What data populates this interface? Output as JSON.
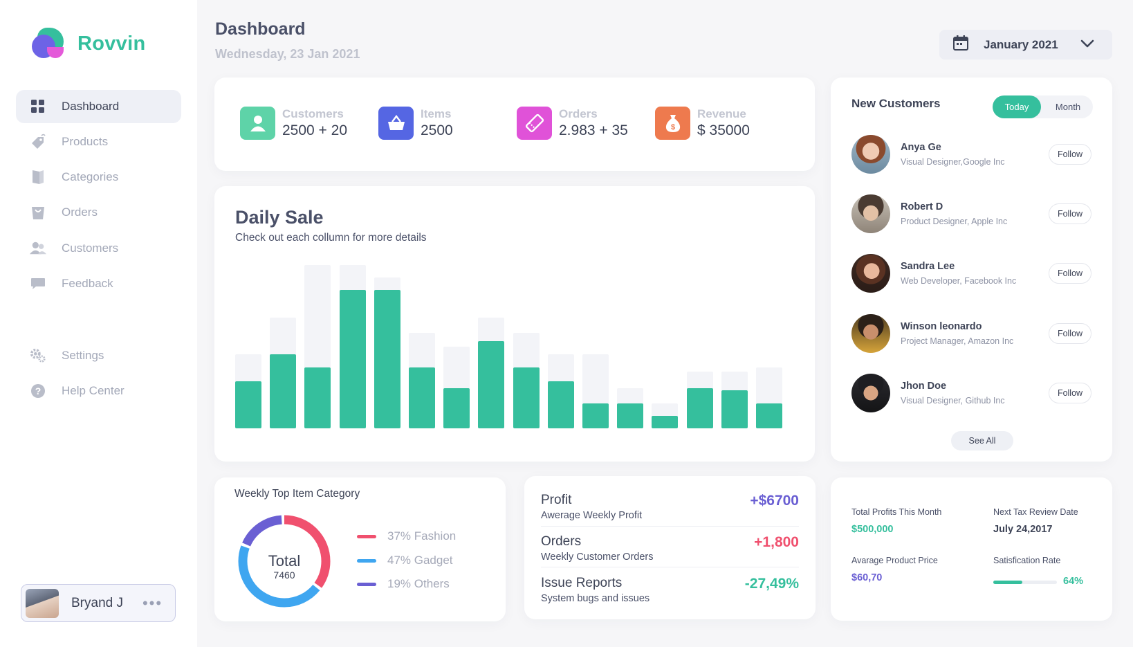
{
  "brand": {
    "name": "Rovvin",
    "color": "#35bf9d"
  },
  "sidebar": {
    "items": [
      {
        "label": "Dashboard",
        "icon": "grid-icon",
        "active": true
      },
      {
        "label": "Products",
        "icon": "tag-icon"
      },
      {
        "label": "Categories",
        "icon": "book-icon"
      },
      {
        "label": "Orders",
        "icon": "bag-icon"
      },
      {
        "label": "Customers",
        "icon": "users-icon"
      },
      {
        "label": "Feedback",
        "icon": "chat-icon"
      },
      {
        "label": "Settings",
        "icon": "gear-icon"
      },
      {
        "label": "Help Center",
        "icon": "help-icon"
      }
    ],
    "user": {
      "name": "Bryand J",
      "more": "•••"
    }
  },
  "header": {
    "title": "Dashboard",
    "date": "Wednesday, 23 Jan 2021",
    "date_picker": "January 2021"
  },
  "stats": [
    {
      "label": "Customers",
      "value": "2500 + 20",
      "color": "#5ed3a8",
      "icon": "user-icon"
    },
    {
      "label": "Items",
      "value": "2500",
      "color": "#5566e3",
      "icon": "basket-icon"
    },
    {
      "label": "Orders",
      "value": "2.983 + 35",
      "color": "#e052d8",
      "icon": "ticket-icon"
    },
    {
      "label": "Revenue",
      "value": "$ 35000",
      "color": "#ee7a4e",
      "icon": "money-bag-icon"
    }
  ],
  "daily_sale": {
    "title": "Daily Sale",
    "subtitle": "Check out each collumn for more details"
  },
  "chart_data": {
    "type": "bar",
    "title": "Daily Sale",
    "series": [
      {
        "values": [
          68,
          107,
          88,
          200,
          200,
          88,
          58,
          126,
          88,
          68,
          36,
          36,
          18,
          58,
          55,
          36
        ]
      },
      {
        "values": [
          107,
          160,
          236,
          236,
          218,
          138,
          118,
          160,
          138,
          107,
          107,
          58,
          36,
          82,
          82,
          88
        ]
      }
    ],
    "ylim": [
      0,
      240
    ],
    "grid": false,
    "colors": {
      "value": "#35bf9d",
      "background": "#f3f4f8"
    }
  },
  "new_customers": {
    "title": "New Customers",
    "tabs": {
      "today": "Today",
      "month": "Month"
    },
    "follow_label": "Follow",
    "see_all": "See All",
    "list": [
      {
        "name": "Anya Ge",
        "role": "Visual Designer,Google Inc"
      },
      {
        "name": "Robert D",
        "role": "Product Designer, Apple Inc"
      },
      {
        "name": "Sandra Lee",
        "role": "Web Developer, Facebook Inc"
      },
      {
        "name": "Winson leonardo",
        "role": "Project Manager, Amazon Inc"
      },
      {
        "name": "Jhon Doe",
        "role": "Visual Designer, Github Inc"
      }
    ]
  },
  "weekly_category": {
    "title": "Weekly Top Item Category",
    "total_label": "Total",
    "total_value": "7460",
    "legend": [
      {
        "text": "37% Fashion",
        "pct": 37,
        "color": "#f0506e"
      },
      {
        "text": "47% Gadget",
        "pct": 47,
        "color": "#3fa6f0"
      },
      {
        "text": "19% Others",
        "pct": 19,
        "color": "#6a5fd3"
      }
    ]
  },
  "metrics": [
    {
      "title": "Profit",
      "sub": "Awerage Weekly Profit",
      "value": "+$6700",
      "color": "#6a5fd3"
    },
    {
      "title": "Orders",
      "sub": "Weekly Customer Orders",
      "value": "+1,800",
      "color": "#f0506e"
    },
    {
      "title": "Issue Reports",
      "sub": "System bugs and issues",
      "value": "-27,49%",
      "color": "#35bf9d"
    }
  ],
  "summary": {
    "total_profits_label": "Total Profits This Month",
    "total_profits_value": "$500,000",
    "tax_label": "Next Tax Review Date",
    "tax_value": "July 24,2017",
    "avg_price_label": "Avarage Product Price",
    "avg_price_value": "$60,70",
    "satisfaction_label": "Satisfication Rate",
    "satisfaction_value": "64%",
    "satisfaction_pct": 0.46
  }
}
